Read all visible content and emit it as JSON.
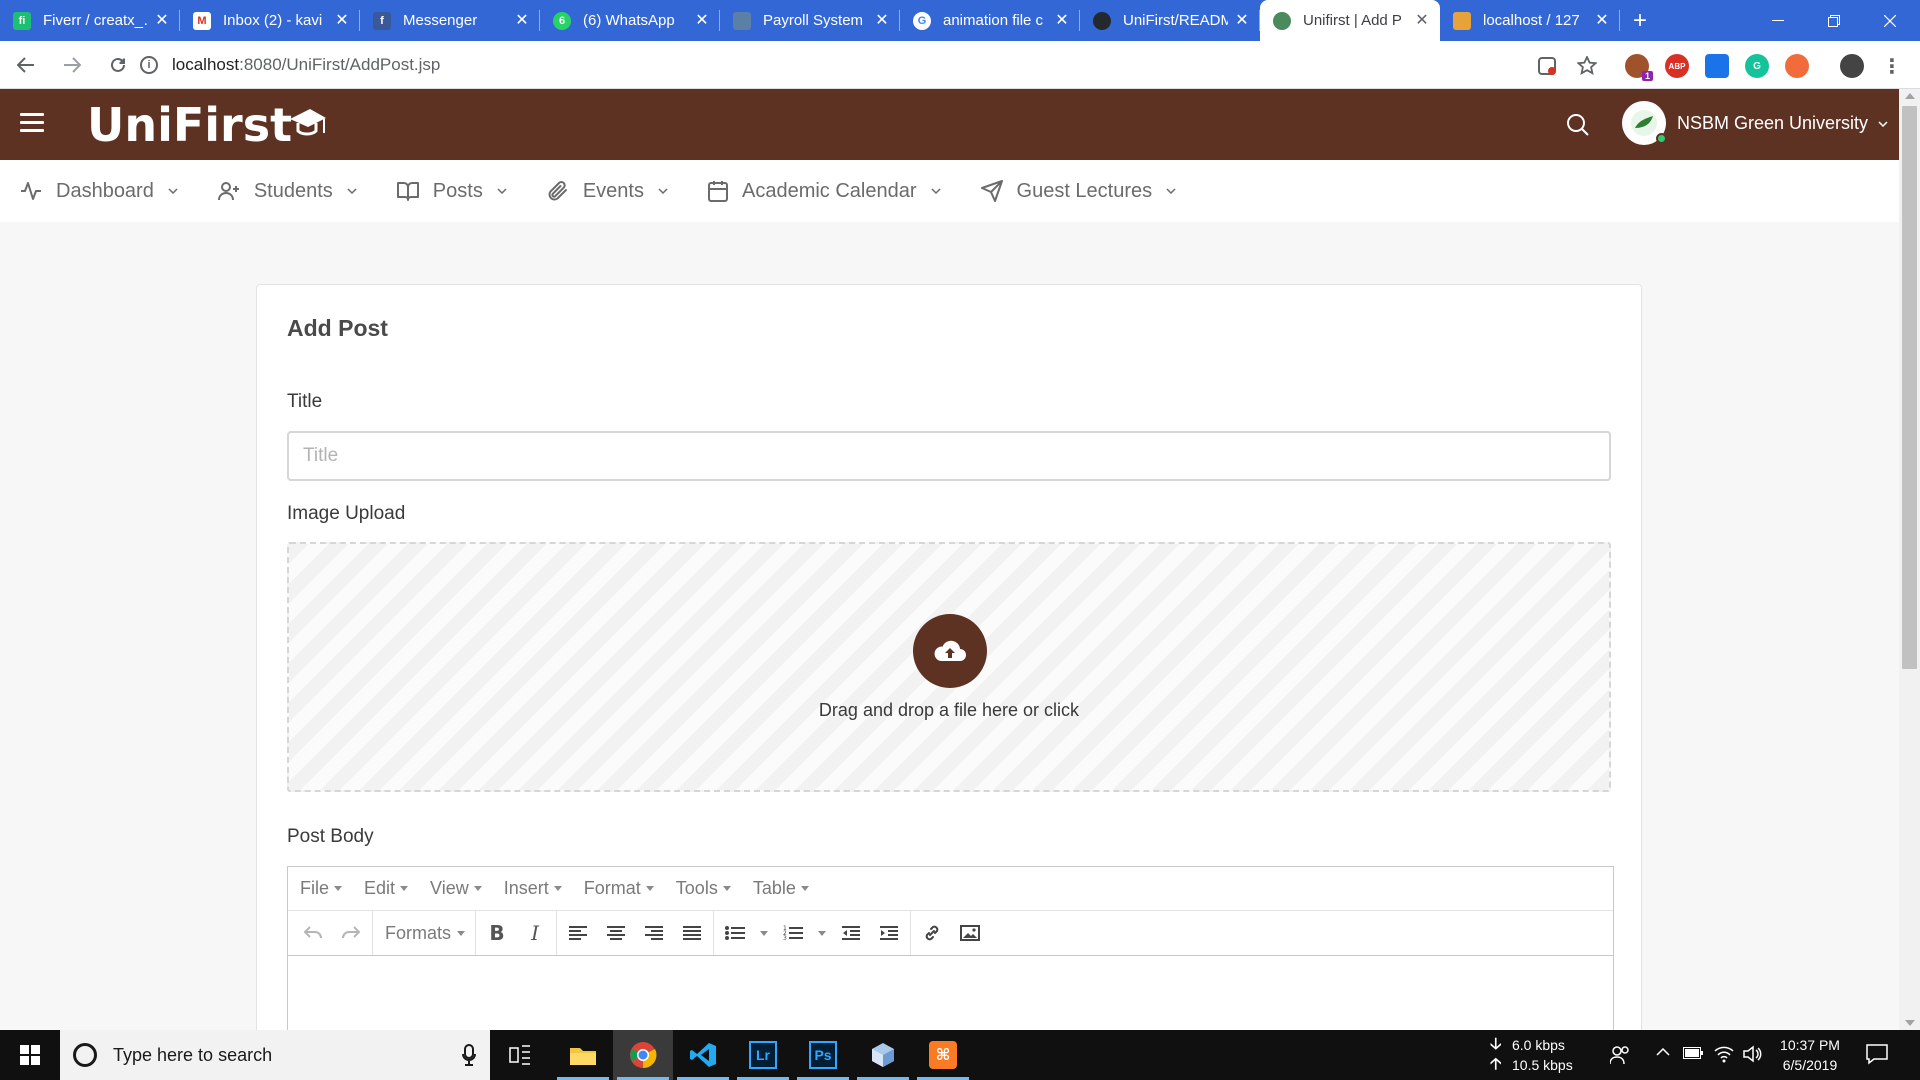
{
  "browser": {
    "tabs": [
      {
        "title": "Fiverr / creatx_…",
        "fav_color": "#1dbf73",
        "fav_text": "fi"
      },
      {
        "title": "Inbox (2) - kavi",
        "fav_color": "#ffffff",
        "fav_text": "M"
      },
      {
        "title": "Messenger",
        "fav_color": "#3b5998",
        "fav_text": "f"
      },
      {
        "title": "(6) WhatsApp",
        "fav_color": "#25d366",
        "fav_text": "6"
      },
      {
        "title": "Payroll System",
        "fav_color": "#5b7fa6",
        "fav_text": ""
      },
      {
        "title": "animation file c",
        "fav_color": "#ffffff",
        "fav_text": "G"
      },
      {
        "title": "UniFirst/READM",
        "fav_color": "#24292e",
        "fav_text": ""
      },
      {
        "title": "Unifirst | Add P",
        "fav_color": "#4a8a5c",
        "fav_text": ""
      },
      {
        "title": "localhost / 127",
        "fav_color": "#e8a23a",
        "fav_text": ""
      }
    ],
    "active_tab_index": 7,
    "url_host": "localhost",
    "url_path": ":8080/UniFirst/AddPost.jsp",
    "ext_badge": "1",
    "ext_abp": "ABP"
  },
  "header": {
    "logo": "UniFirst",
    "user_name": "NSBM Green University"
  },
  "nav": {
    "items": [
      {
        "label": "Dashboard",
        "icon": "activity-icon"
      },
      {
        "label": "Students",
        "icon": "user-plus-icon"
      },
      {
        "label": "Posts",
        "icon": "book-open-icon"
      },
      {
        "label": "Events",
        "icon": "paperclip-icon"
      },
      {
        "label": "Academic Calendar",
        "icon": "calendar-icon"
      },
      {
        "label": "Guest Lectures",
        "icon": "send-icon"
      }
    ]
  },
  "form": {
    "heading": "Add Post",
    "title_label": "Title",
    "title_placeholder": "Title",
    "title_value": "",
    "image_label": "Image Upload",
    "dropzone_text": "Drag and drop a file here or click",
    "body_label": "Post Body"
  },
  "editor": {
    "menus": [
      "File",
      "Edit",
      "View",
      "Insert",
      "Format",
      "Tools",
      "Table"
    ],
    "formats_label": "Formats"
  },
  "taskbar": {
    "search_placeholder": "Type here to search",
    "net_down": "6.0 kbps",
    "net_up": "10.5 kbps",
    "time": "10:37 PM",
    "date": "6/5/2019"
  },
  "colors": {
    "brand_brown": "#5d3222",
    "chrome_blue": "#3367d6"
  }
}
